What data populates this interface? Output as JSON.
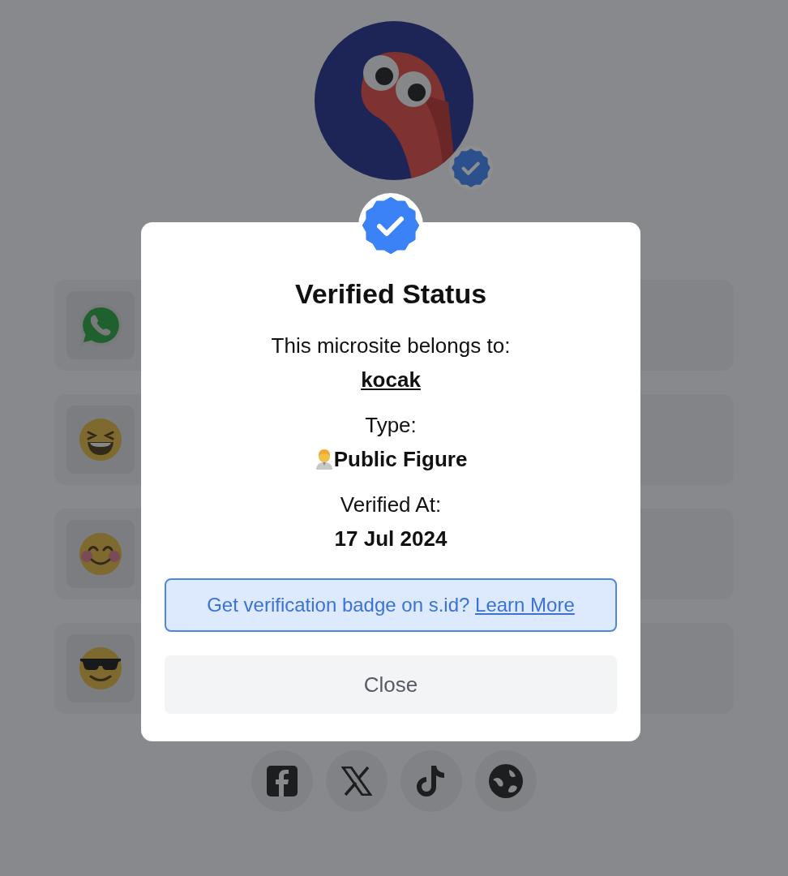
{
  "profile": {
    "verified": true
  },
  "links": [
    {
      "kind": "whatsapp"
    },
    {
      "kind": "laughing"
    },
    {
      "kind": "smiling"
    },
    {
      "kind": "sunglasses"
    }
  ],
  "socials": [
    {
      "kind": "facebook"
    },
    {
      "kind": "x"
    },
    {
      "kind": "tiktok"
    },
    {
      "kind": "globe"
    }
  ],
  "modal": {
    "title": "Verified Status",
    "owner_label": "This microsite belongs to:",
    "owner": "kocak",
    "type_label": "Type:",
    "type": "Public Figure",
    "verified_label": "Verified At:",
    "verified_at": "17 Jul 2024",
    "notice_text": "Get verification badge on s.id?",
    "notice_link": "Learn More",
    "close_button": "Close"
  }
}
